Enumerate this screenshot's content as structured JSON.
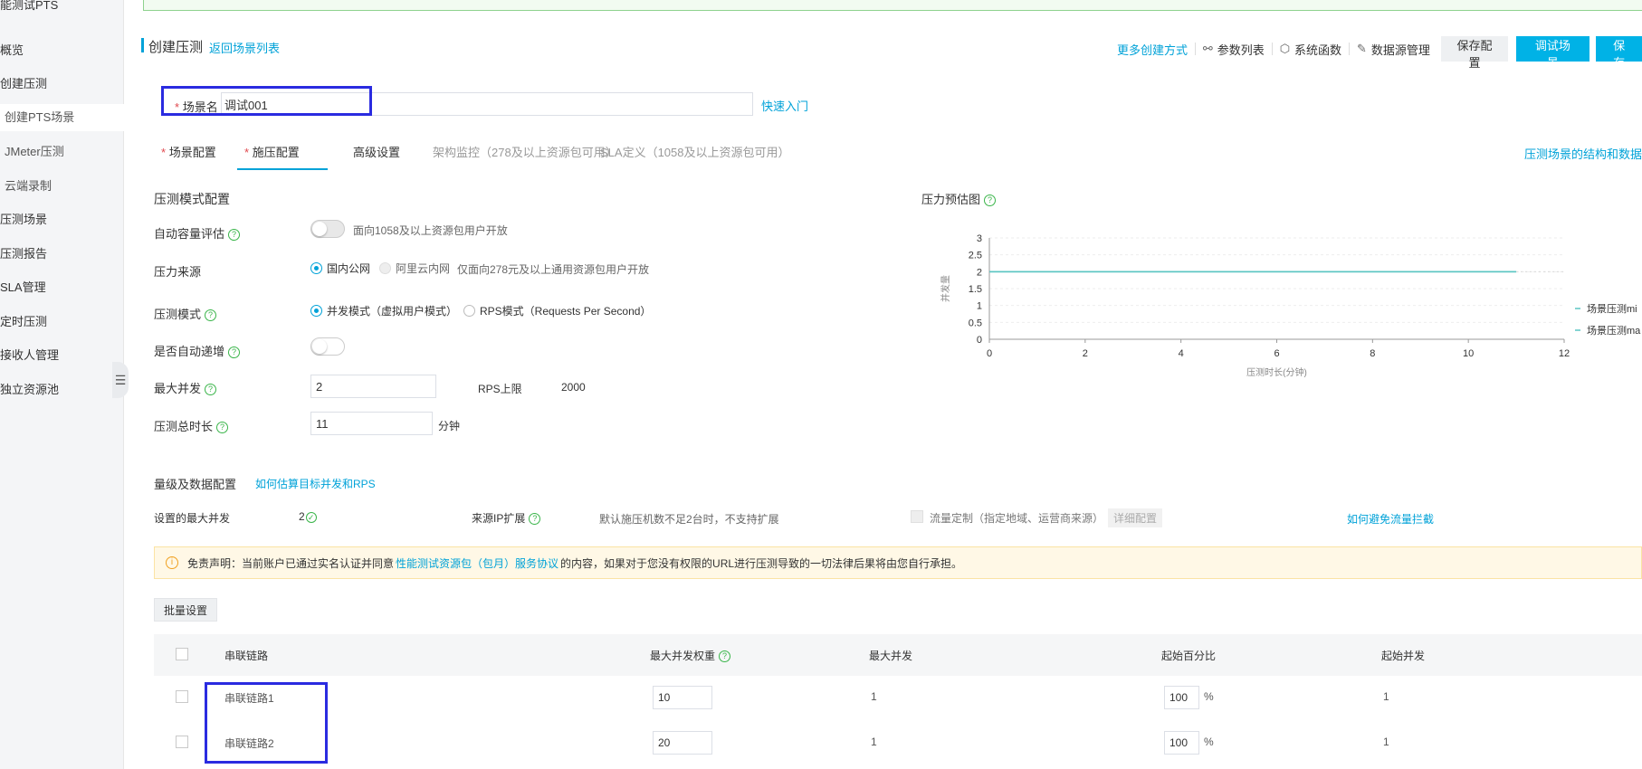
{
  "sidebar": {
    "title": "能测试PTS",
    "items": [
      {
        "label": "概览"
      },
      {
        "label": "创建压测"
      },
      {
        "label": "创建PTS场景"
      },
      {
        "label": "JMeter压测"
      },
      {
        "label": "云端录制"
      },
      {
        "label": "压测场景"
      },
      {
        "label": "压测报告"
      },
      {
        "label": "SLA管理"
      },
      {
        "label": "定时压测"
      },
      {
        "label": "接收人管理"
      },
      {
        "label": "独立资源池"
      }
    ],
    "collapse_icon": "menu-collapse-icon"
  },
  "header": {
    "title": "创建压测",
    "back_link": "返回场景列表",
    "more_create": "更多创建方式",
    "param_list": "参数列表",
    "system_func": "系统函数",
    "datasource_mgmt": "数据源管理",
    "save_config": "保存配置",
    "debug_scene": "调试场景",
    "save_start": "保存",
    "icons": {
      "param": "share-nodes-icon",
      "func": "cube-icon",
      "datasource": "edit-icon"
    }
  },
  "scene": {
    "label": "场景名",
    "value": "调试001",
    "quick_start": "快速入门"
  },
  "tabs": {
    "items": [
      "场景配置",
      "施压配置",
      "高级设置",
      "架构监控（278及以上资源包可用）",
      "SLA定义（1058及以上资源包可用）"
    ],
    "active": "施压配置",
    "right_link": "压测场景的结构和数据"
  },
  "pressure": {
    "section_title": "压测模式配置",
    "auto_capacity_label": "自动容量评估",
    "auto_capacity_note": "面向1058及以上资源包用户开放",
    "source_label": "压力来源",
    "source_options": [
      "国内公网",
      "阿里云内网"
    ],
    "source_note": "仅面向278元及以上通用资源包用户开放",
    "mode_label": "压测模式",
    "mode_options": [
      "并发模式（虚拟用户模式）",
      "RPS模式（Requests Per Second）"
    ],
    "auto_increase_label": "是否自动递增",
    "max_concurrency_label": "最大并发",
    "max_concurrency_value": "2",
    "rps_limit_label": "RPS上限",
    "rps_limit_value": "2000",
    "duration_label": "压测总时长",
    "duration_value": "11",
    "duration_unit": "分钟"
  },
  "chart_data": {
    "type": "line",
    "title": "压力预估图",
    "xlabel": "压测时长(分钟)",
    "ylabel": "并发量",
    "xlim": [
      0,
      12
    ],
    "ylim": [
      0,
      3
    ],
    "x_ticks": [
      "0",
      "2",
      "4",
      "6",
      "8",
      "10",
      "12"
    ],
    "y_ticks": [
      "0",
      "0.5",
      "1",
      "1.5",
      "2",
      "2.5",
      "3"
    ],
    "series": [
      {
        "name": "场景压测mi",
        "x": [
          0,
          11
        ],
        "y": [
          2,
          2
        ],
        "color": "#5bc6c2"
      },
      {
        "name": "场景压测ma",
        "x": [
          0,
          11
        ],
        "y": [
          2,
          2
        ],
        "color": "#5bc6c2"
      }
    ],
    "legend_position": "right"
  },
  "volume": {
    "section_title": "量级及数据配置",
    "help_link": "如何估算目标并发和RPS",
    "max_set_label": "设置的最大并发",
    "max_set_value": "2",
    "ip_ext_label": "来源IP扩展",
    "ip_ext_note": "默认施压机数不足2台时，不支持扩展",
    "flow_custom_label": "流量定制（指定地域、运营商来源）",
    "detail_config": "详细配置",
    "avoid_link": "如何避免流量拦截"
  },
  "disclaimer": {
    "prefix": "免责声明：当前账户已通过实名认证并同意",
    "link": "性能测试资源包（包月）服务协议",
    "suffix": "的内容，如果对于您没有权限的URL进行压测导致的一切法律后果将由您自行承担。"
  },
  "batch_button": "批量设置",
  "table": {
    "headers": [
      "串联链路",
      "最大并发权重",
      "最大并发",
      "起始百分比",
      "起始并发"
    ],
    "rows": [
      {
        "name": "串联链路1",
        "weight": "10",
        "max": "1",
        "start_pct": "100",
        "pct_unit": "%",
        "start": "1"
      },
      {
        "name": "串联链路2",
        "weight": "20",
        "max": "1",
        "start_pct": "100",
        "pct_unit": "%",
        "start": "1"
      }
    ]
  },
  "colors": {
    "accent": "#00a2d8",
    "primary_button": "#00b2e6",
    "highlight_box": "#2a2be0"
  }
}
